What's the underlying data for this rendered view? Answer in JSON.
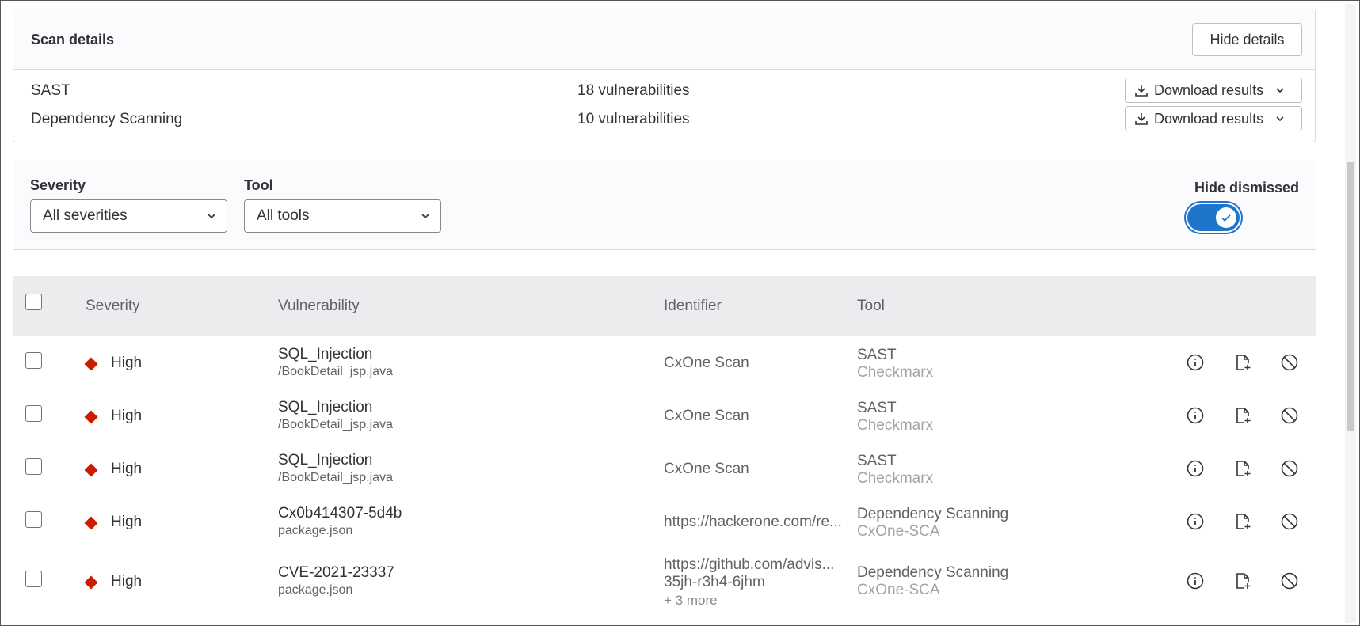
{
  "scan_details": {
    "title": "Scan details",
    "hide_details_label": "Hide details",
    "rows": [
      {
        "name": "SAST",
        "count": "18 vulnerabilities",
        "download_label": "Download results"
      },
      {
        "name": "Dependency Scanning",
        "count": "10 vulnerabilities",
        "download_label": "Download results"
      }
    ]
  },
  "filters": {
    "severity_label": "Severity",
    "severity_value": "All severities",
    "tool_label": "Tool",
    "tool_value": "All tools",
    "hide_dismissed_label": "Hide dismissed",
    "hide_dismissed_on": true
  },
  "table": {
    "headers": {
      "severity": "Severity",
      "vulnerability": "Vulnerability",
      "identifier": "Identifier",
      "tool": "Tool"
    },
    "rows": [
      {
        "severity": "High",
        "title": "SQL_Injection",
        "file": "/BookDetail_jsp.java",
        "identifier": "CxOne Scan",
        "identifier_line2": "",
        "identifier_more": "",
        "tool": "SAST",
        "scanner": "Checkmarx"
      },
      {
        "severity": "High",
        "title": "SQL_Injection",
        "file": "/BookDetail_jsp.java",
        "identifier": "CxOne Scan",
        "identifier_line2": "",
        "identifier_more": "",
        "tool": "SAST",
        "scanner": "Checkmarx"
      },
      {
        "severity": "High",
        "title": "SQL_Injection",
        "file": "/BookDetail_jsp.java",
        "identifier": "CxOne Scan",
        "identifier_line2": "",
        "identifier_more": "",
        "tool": "SAST",
        "scanner": "Checkmarx"
      },
      {
        "severity": "High",
        "title": "Cx0b414307-5d4b",
        "file": "package.json",
        "identifier": "https://hackerone.com/re...",
        "identifier_line2": "",
        "identifier_more": "",
        "tool": "Dependency Scanning",
        "scanner": "CxOne-SCA"
      },
      {
        "severity": "High",
        "title": "CVE-2021-23337",
        "file": "package.json",
        "identifier": "https://github.com/advis...",
        "identifier_line2": "35jh-r3h4-6jhm",
        "identifier_more": "+ 3 more",
        "tool": "Dependency Scanning",
        "scanner": "CxOne-SCA"
      }
    ]
  },
  "colors": {
    "severity_high": "#c91c00",
    "toggle_on": "#1f75cb"
  },
  "icons": {
    "download": "download-icon",
    "chevron": "chevron-down-icon",
    "check": "check-icon",
    "severity": "severity-high-icon",
    "details": "info-icon",
    "create_issue": "create-issue-icon",
    "dismiss": "dismiss-icon"
  }
}
